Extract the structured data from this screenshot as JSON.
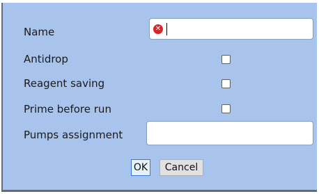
{
  "form": {
    "name_label": "Name",
    "name_value": "",
    "antidrop_label": "Antidrop",
    "antidrop_checked": false,
    "reagent_label": "Reagent saving",
    "reagent_checked": false,
    "prime_label": "Prime before run",
    "prime_checked": false,
    "pumps_label": "Pumps assignment",
    "pumps_value": "",
    "error_icon": "error-x-icon"
  },
  "buttons": {
    "ok_label": "OK",
    "cancel_label": "Cancel"
  },
  "colors": {
    "dialog_background": "#a9c4ec",
    "error": "#d8262a"
  }
}
